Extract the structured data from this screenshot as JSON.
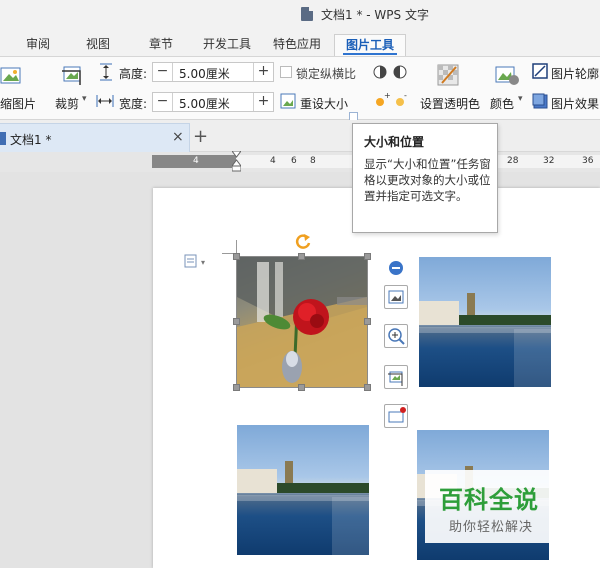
{
  "window": {
    "title": "文档1 * - WPS 文字"
  },
  "ribbon_tabs": [
    {
      "label": "审阅",
      "active": false
    },
    {
      "label": "视图",
      "active": false
    },
    {
      "label": "章节",
      "active": false
    },
    {
      "label": "开发工具",
      "active": false
    },
    {
      "label": "特色应用",
      "active": false
    },
    {
      "label": "图片工具",
      "active": true
    }
  ],
  "ribbon": {
    "compress_label": "缩图片",
    "crop_label": "裁剪",
    "height_label": "高度:",
    "height_value": "5.00厘米",
    "width_label": "宽度:",
    "width_value": "5.00厘米",
    "lock_ratio_label": "锁定纵横比",
    "reset_size_label": "重设大小",
    "transparent_label": "设置透明色",
    "color_label": "颜色",
    "outline_label": "图片轮廓",
    "effects_label": "图片效果"
  },
  "doc_tab": {
    "name": "文档1 *",
    "close": "×",
    "new": "+"
  },
  "ruler": {
    "ticks_dark": [
      "4",
      "2"
    ],
    "ticks_light": [
      "2",
      "4",
      "6",
      "8",
      "28",
      "32",
      "36"
    ]
  },
  "tooltip": {
    "title": "大小和位置",
    "body": "显示“大小和位置”任务窗格以更改对象的大小或位置并指定可选文字。"
  },
  "watermark": {
    "main": "百科全说",
    "sub": "助你轻松解决"
  },
  "colors": {
    "accent": "#2f74d0",
    "watermark_green": "#2e9e3a",
    "ruler_gray": "#878787"
  }
}
